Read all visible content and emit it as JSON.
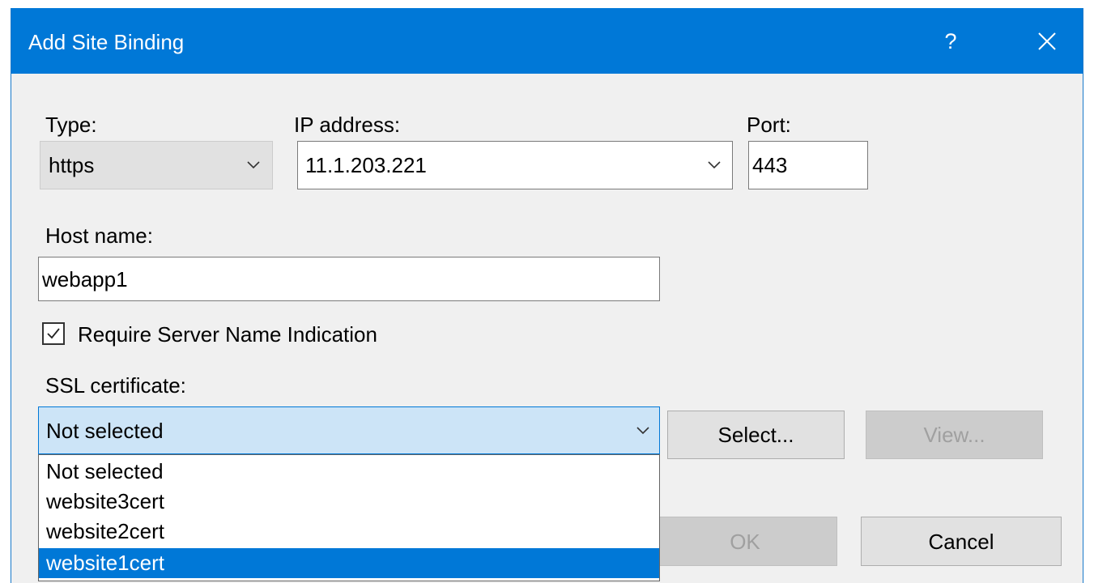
{
  "dialog": {
    "title": "Add Site Binding",
    "help_label": "?",
    "close_icon": "close-icon"
  },
  "type": {
    "label": "Type:",
    "value": "https"
  },
  "ip_address": {
    "label": "IP address:",
    "value": "11.1.203.221"
  },
  "port": {
    "label": "Port:",
    "value": "443"
  },
  "host_name": {
    "label": "Host name:",
    "value": "webapp1"
  },
  "sni": {
    "label": "Require Server Name Indication",
    "checked": true
  },
  "ssl_certificate": {
    "label": "SSL certificate:",
    "value": "Not selected",
    "options": [
      "Not selected",
      "website3cert",
      "website2cert",
      "website1cert"
    ],
    "highlighted": "website1cert"
  },
  "buttons": {
    "select": "Select...",
    "view": "View...",
    "ok": "OK",
    "cancel": "Cancel"
  },
  "colors": {
    "accent": "#0078d7",
    "dialog_bg": "#f0f0f0",
    "selection_bg": "#cce4f7"
  }
}
